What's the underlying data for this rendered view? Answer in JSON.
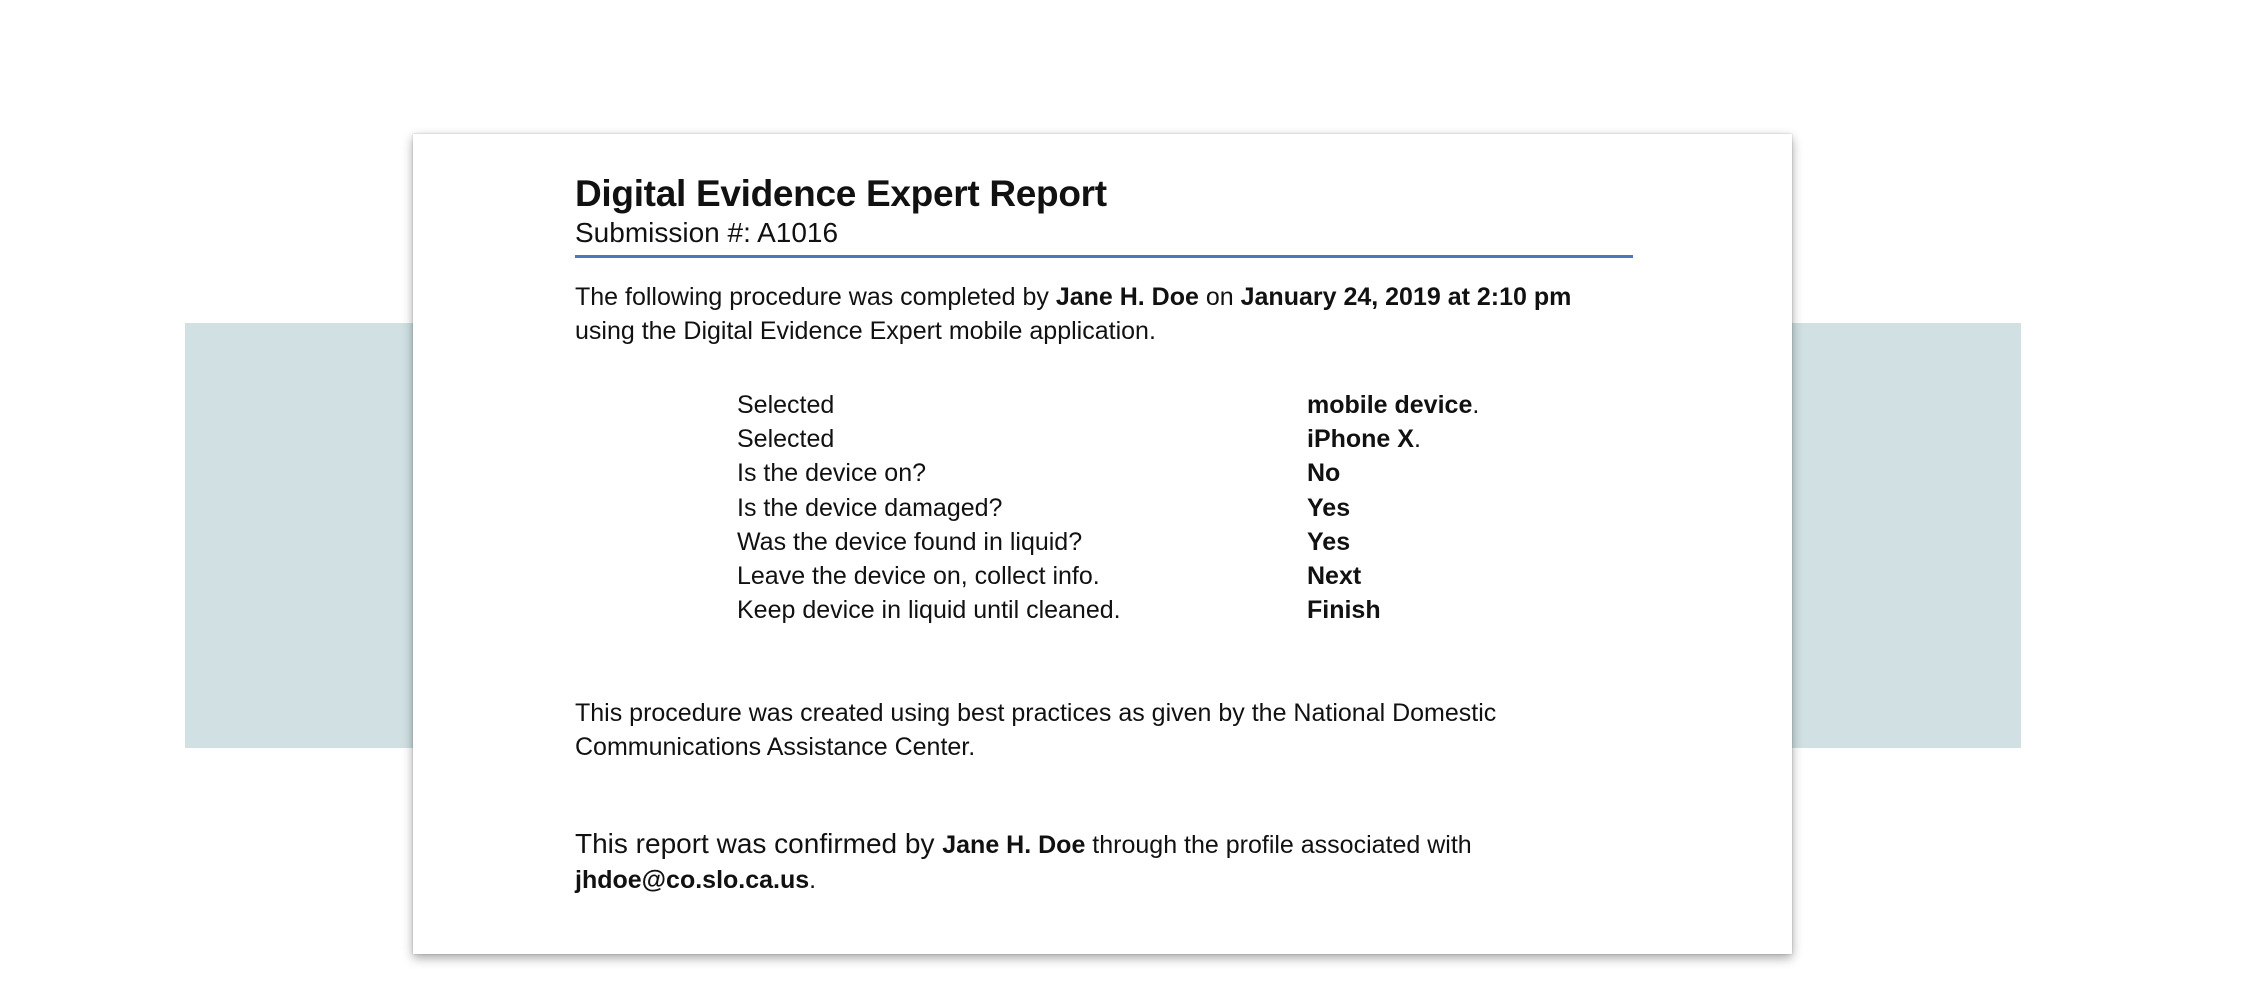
{
  "report": {
    "title": "Digital Evidence Expert Report",
    "submission": "Submission #: A1016",
    "intro": {
      "part1": "The following procedure was completed by ",
      "examiner": "Jane H. Doe",
      "part2": " on ",
      "datetime": "January 24, 2019 at 2:10 pm",
      "part3": "using the Digital Evidence Expert mobile application."
    },
    "steps": [
      {
        "question": "Selected",
        "answer": "mobile device",
        "suffix": "."
      },
      {
        "question": "Selected",
        "answer": "iPhone X",
        "suffix": "."
      },
      {
        "question": "Is the device on?",
        "answer": "No",
        "suffix": ""
      },
      {
        "question": "Is the device damaged?",
        "answer": "Yes",
        "suffix": ""
      },
      {
        "question": "Was the device found in liquid?",
        "answer": "Yes",
        "suffix": ""
      },
      {
        "question": "Leave the device on, collect info.",
        "answer": "Next",
        "suffix": ""
      },
      {
        "question": "Keep device in liquid until cleaned.",
        "answer": "Finish",
        "suffix": ""
      }
    ],
    "practices": "This procedure was created using best practices as given by the National Domestic Communications Assistance Center.",
    "confirmation": {
      "part1": "This report was confirmed by ",
      "examiner": "Jane H. Doe",
      "part2": " through the profile associated with",
      "email": "jhdoe@co.slo.ca.us",
      "part3": "."
    }
  },
  "colors": {
    "backdrop": "#d0e0e3",
    "rule": "#4a78b8",
    "card": "#ffffff"
  }
}
